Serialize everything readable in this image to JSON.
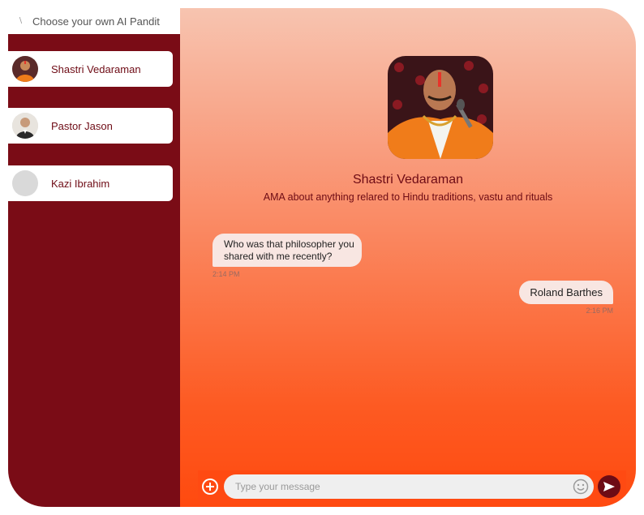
{
  "sidebar": {
    "title": "Choose your own AI Pandit",
    "contacts": [
      {
        "name": "Shastri Vedaraman",
        "avatar": "saffron-robed-man-avatar"
      },
      {
        "name": "Pastor Jason",
        "avatar": "suited-man-avatar"
      },
      {
        "name": "Kazi Ibrahim",
        "avatar": "placeholder-avatar"
      }
    ]
  },
  "profile": {
    "name": "Shastri Vedaraman",
    "description": "AMA about anything relared to Hindu traditions, vastu and rituals"
  },
  "messages": [
    {
      "direction": "incoming",
      "text": "Who was that philosopher you shared with me recently?",
      "time": "2:14 PM"
    },
    {
      "direction": "outgoing",
      "text": "Roland Barthes",
      "time": "2:16 PM"
    }
  ],
  "composer": {
    "placeholder": "Type your message"
  },
  "colors": {
    "sidebar": "#7a0c16",
    "accent": "#ff4a0f",
    "text_dark_red": "#6e0b15",
    "bubble": "#f8e6e2"
  }
}
